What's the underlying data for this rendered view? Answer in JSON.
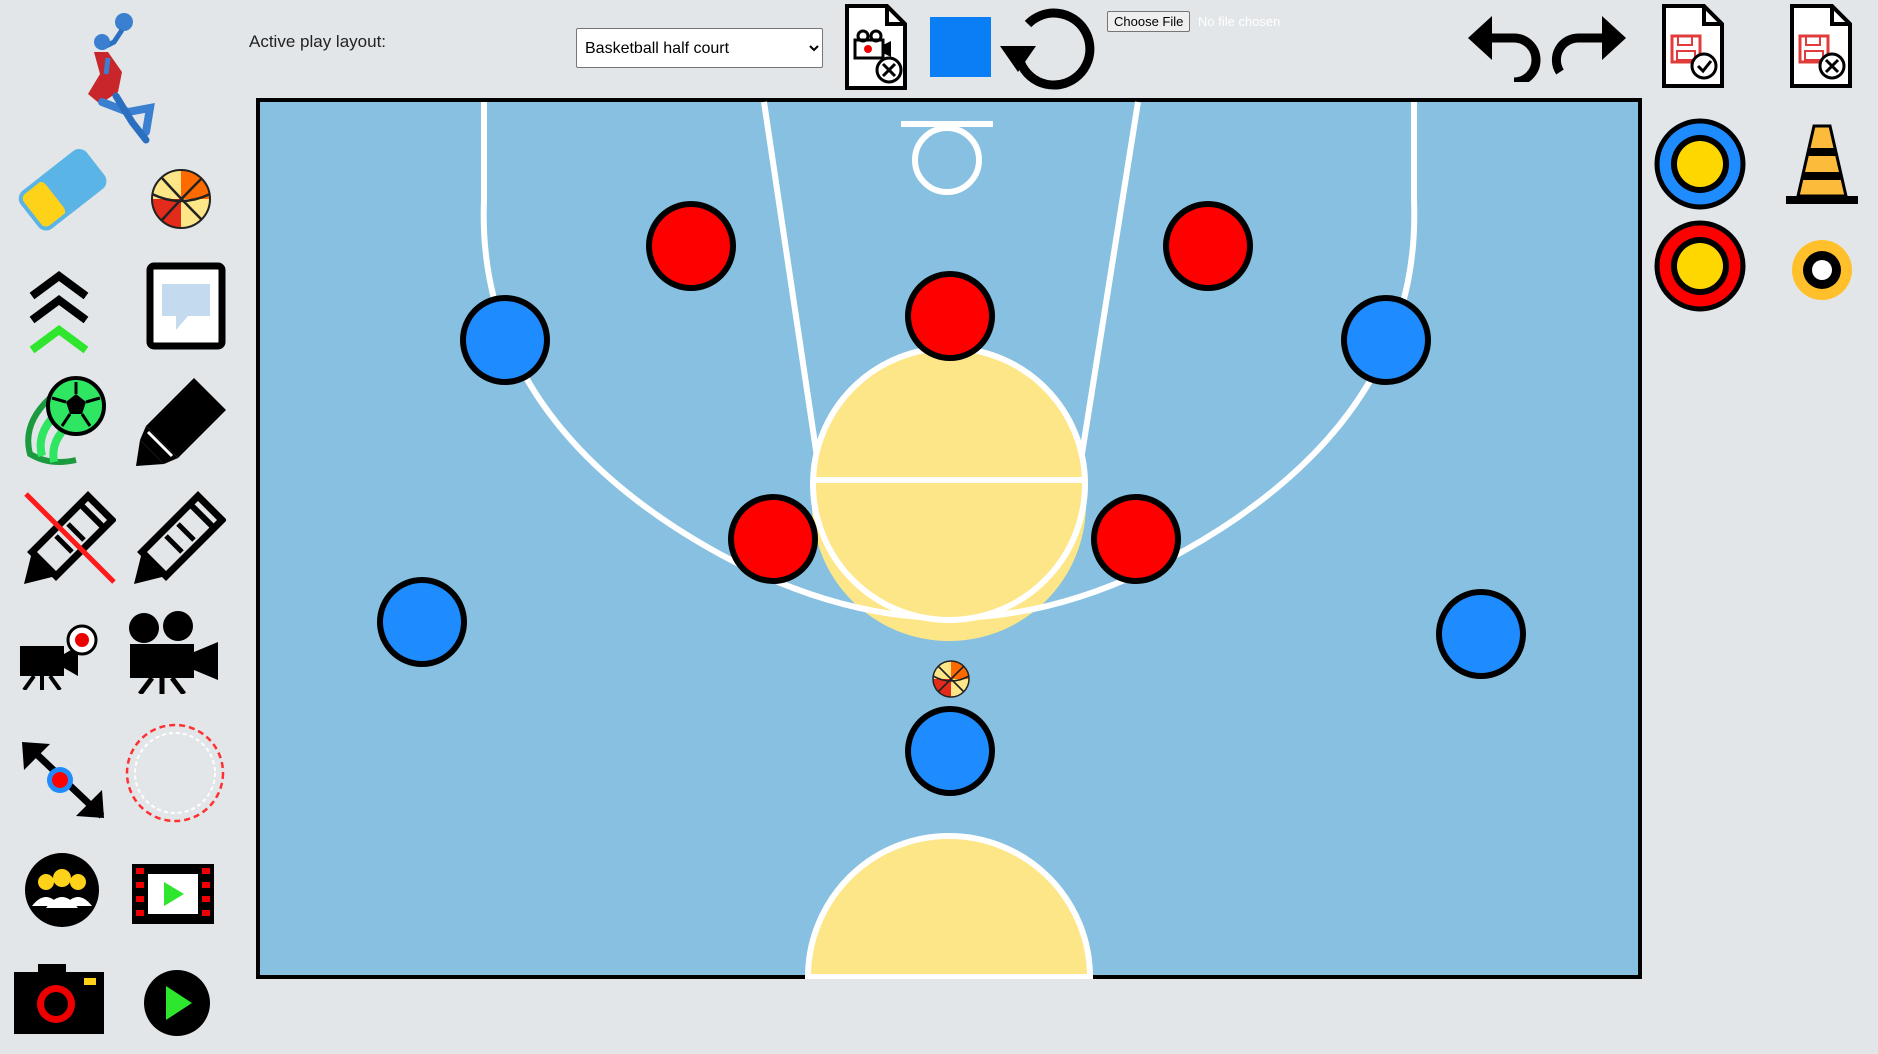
{
  "toolbar": {
    "layout_label": "Active play layout:",
    "layout_selected": "Basketball half court",
    "file_button_label": "Choose File",
    "file_status": "No file chosen",
    "color_swatch": "#0a7ff5"
  },
  "left_tools": [
    {
      "name": "dunker-logo-icon"
    },
    {
      "name": "eraser-icon"
    },
    {
      "name": "basketball-icon"
    },
    {
      "name": "chevrons-up-icon"
    },
    {
      "name": "speech-bubble-icon"
    },
    {
      "name": "kicked-ball-icon"
    },
    {
      "name": "marker-icon"
    },
    {
      "name": "no-pencil-icon"
    },
    {
      "name": "pencil-icon"
    },
    {
      "name": "record-camera-icon"
    },
    {
      "name": "movie-camera-icon"
    },
    {
      "name": "resize-arrows-icon"
    },
    {
      "name": "dashed-circle-icon"
    },
    {
      "name": "team-icon"
    },
    {
      "name": "film-play-icon"
    },
    {
      "name": "camera-icon"
    },
    {
      "name": "play-icon"
    }
  ],
  "right_tools": [
    {
      "name": "blue-player-token-icon"
    },
    {
      "name": "cone-icon"
    },
    {
      "name": "red-player-token-icon"
    },
    {
      "name": "ring-marker-icon"
    }
  ],
  "colors": {
    "court": "#87c0e0",
    "key": "#fde687",
    "team_red": "#ff0000",
    "team_blue": "#1e8bff",
    "background": "#e2e6e9"
  }
}
